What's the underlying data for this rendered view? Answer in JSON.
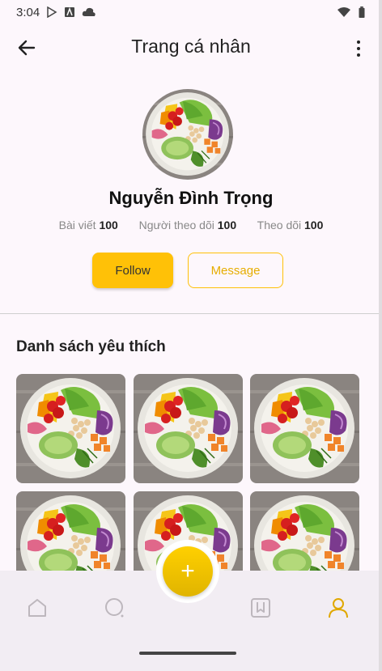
{
  "status_bar": {
    "time": "3:04"
  },
  "app_bar": {
    "title": "Trang cá nhân"
  },
  "profile": {
    "name": "Nguyễn Đình Trọng",
    "stats": [
      {
        "label": "Bài viết",
        "value": "100"
      },
      {
        "label": "Người theo dõi",
        "value": "100"
      },
      {
        "label": "Theo dõi",
        "value": "100"
      }
    ],
    "follow_label": "Follow",
    "message_label": "Message"
  },
  "favorites": {
    "title": "Danh sách yêu thích",
    "item_count": 6
  },
  "bottom_nav": {
    "items": [
      "home-icon",
      "search-icon",
      "bookmark-icon",
      "profile-icon"
    ],
    "active": "profile-icon",
    "fab_label": "+"
  },
  "colors": {
    "accent": "#ffc107",
    "background": "#fdf7fc",
    "nav_bg": "#f2edf3"
  }
}
